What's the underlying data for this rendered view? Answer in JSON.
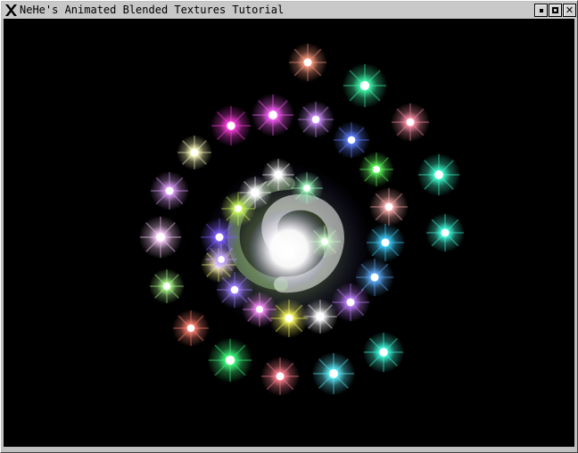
{
  "window": {
    "title": "NeHe's Animated Blended Textures Tutorial",
    "controls": [
      "minimize",
      "maximize",
      "close"
    ],
    "close_glyph": "✕",
    "logo_icon": "x-window-logo-icon"
  },
  "scene": {
    "background": "#000000",
    "core": {
      "color": "#ffffff"
    },
    "stars": [
      {
        "color": "#ff9a80",
        "size": 1.0
      },
      {
        "color": "#40ffb0",
        "size": 1.15
      },
      {
        "color": "#ff90a8",
        "size": 1.0
      },
      {
        "color": "#40ffd0",
        "size": 1.1
      },
      {
        "color": "#40ffe0",
        "size": 1.0
      },
      {
        "color": "#40d0ff",
        "size": 1.0
      },
      {
        "color": "#40ffe0",
        "size": 1.05
      },
      {
        "color": "#60f0ff",
        "size": 1.1
      },
      {
        "color": "#ff8090",
        "size": 1.0
      },
      {
        "color": "#40ff80",
        "size": 1.15
      },
      {
        "color": "#ff8070",
        "size": 0.95
      },
      {
        "color": "#b0ff90",
        "size": 0.9
      },
      {
        "color": "#ffd0ff",
        "size": 1.1
      },
      {
        "color": "#e0a0ff",
        "size": 1.0
      },
      {
        "color": "#ffffc0",
        "size": 0.9
      },
      {
        "color": "#ff40e0",
        "size": 1.05
      },
      {
        "color": "#ff60ff",
        "size": 1.1
      },
      {
        "color": "#d090ff",
        "size": 0.95
      },
      {
        "color": "#6080ff",
        "size": 0.95
      },
      {
        "color": "#60ff60",
        "size": 0.9
      },
      {
        "color": "#ffb0b0",
        "size": 1.0
      },
      {
        "color": "#60b0ff",
        "size": 1.0
      },
      {
        "color": "#c080ff",
        "size": 1.0
      },
      {
        "color": "#ffffff",
        "size": 0.9
      },
      {
        "color": "#ffff60",
        "size": 1.0
      },
      {
        "color": "#ff90ff",
        "size": 0.9
      },
      {
        "color": "#a080ff",
        "size": 0.95
      },
      {
        "color": "#ffff80",
        "size": 0.9
      },
      {
        "color": "#8060ff",
        "size": 1.0
      },
      {
        "color": "#d0ff60",
        "size": 0.9
      },
      {
        "color": "#ffffff",
        "size": 0.85
      },
      {
        "color": "#ffffff",
        "size": 0.85
      },
      {
        "color": "#d0ffd0",
        "size": 0.85
      },
      {
        "color": "#c0a0ff",
        "size": 0.85
      },
      {
        "color": "#a0ffc0",
        "size": 0.85
      }
    ]
  }
}
